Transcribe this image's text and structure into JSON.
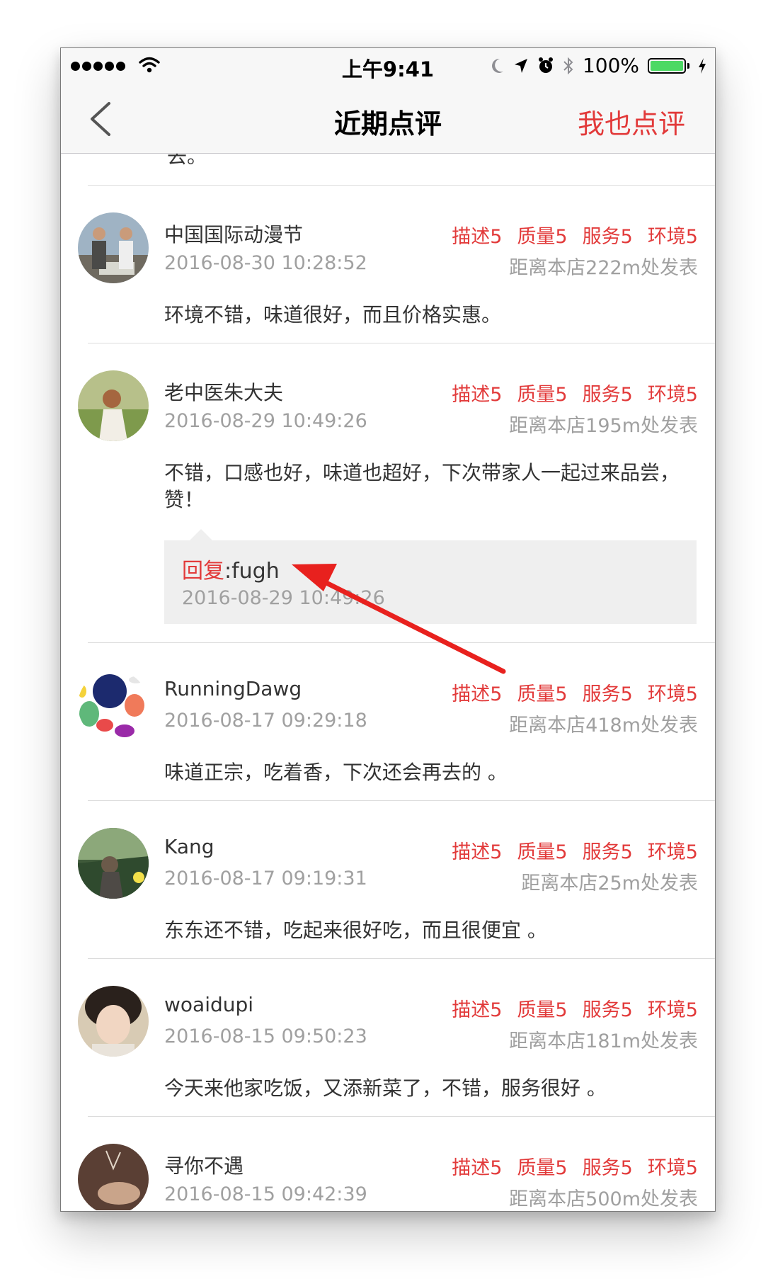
{
  "status_bar": {
    "time": "上午9:41",
    "battery": "100%",
    "battery_level": 1.0
  },
  "nav": {
    "title": "近期点评",
    "action_label": "我也点评"
  },
  "previous_tail": "去。",
  "reviews": [
    {
      "name": "中国国际动漫节",
      "time": "2016-08-30 10:28:52",
      "ratings": [
        "描述5",
        "质量5",
        "服务5",
        "环境5"
      ],
      "distance": "距离本店222m处发表",
      "comment": "环境不错，味道很好，而且价格实惠。"
    },
    {
      "name": "老中医朱大夫",
      "time": "2016-08-29 10:49:26",
      "ratings": [
        "描述5",
        "质量5",
        "服务5",
        "环境5"
      ],
      "distance": "距离本店195m处发表",
      "comment": "不错，口感也好，味道也超好，下次带家人一起过来品尝，赞！",
      "reply": {
        "label": "回复",
        "text": ":fugh",
        "time": "2016-08-29 10:49:26"
      }
    },
    {
      "name": "RunningDawg",
      "time": "2016-08-17 09:29:18",
      "ratings": [
        "描述5",
        "质量5",
        "服务5",
        "环境5"
      ],
      "distance": "距离本店418m处发表",
      "comment": "味道正宗，吃着香，下次还会再去的 。"
    },
    {
      "name": "Kang",
      "time": "2016-08-17 09:19:31",
      "ratings": [
        "描述5",
        "质量5",
        "服务5",
        "环境5"
      ],
      "distance": "距离本店25m处发表",
      "comment": "东东还不错，吃起来很好吃，而且很便宜 。"
    },
    {
      "name": "woaidupi",
      "time": "2016-08-15 09:50:23",
      "ratings": [
        "描述5",
        "质量5",
        "服务5",
        "环境5"
      ],
      "distance": "距离本店181m处发表",
      "comment": "今天来他家吃饭，又添新菜了，不错，服务很好 。"
    },
    {
      "name": "寻你不遇",
      "time": "2016-08-15 09:42:39",
      "ratings": [
        "描述5",
        "质量5",
        "服务5",
        "环境5"
      ],
      "distance": "距离本店500m处发表",
      "comment": ""
    }
  ],
  "colors": {
    "accent": "#e23a3a",
    "secondary_text": "#a0a0a0",
    "arrow": "#e8211e"
  }
}
